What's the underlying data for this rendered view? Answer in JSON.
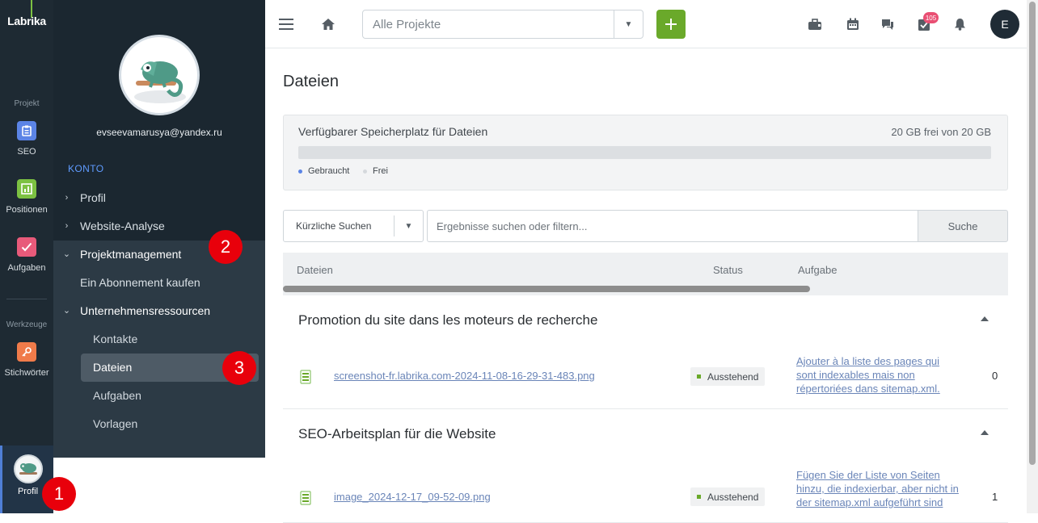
{
  "rail": {
    "logo": "Labrika",
    "section_project": "Projekt",
    "section_tools": "Werkzeuge",
    "items": [
      {
        "label": "SEO",
        "icon": "clipboard-icon",
        "color": "#5b84e6"
      },
      {
        "label": "Positionen",
        "icon": "chart-icon",
        "color": "#7cc142"
      },
      {
        "label": "Aufgaben",
        "icon": "check-icon",
        "color": "#e85a7a"
      },
      {
        "label": "Stichwörter",
        "icon": "key-icon",
        "color": "#f07b4a"
      }
    ],
    "profile_label": "Profil"
  },
  "account": {
    "email": "evseevamarusya@yandex.ru",
    "section": "KONTO",
    "menu": [
      {
        "label": "Profil",
        "expanded": false
      },
      {
        "label": "Website-Analyse",
        "expanded": false
      },
      {
        "label": "Projektmanagement",
        "expanded": true
      },
      {
        "label": "Ein Abonnement kaufen"
      },
      {
        "label": "Unternehmensressourcen",
        "expanded": true
      }
    ],
    "submenu": [
      {
        "label": "Kontakte"
      },
      {
        "label": "Dateien",
        "active": true
      },
      {
        "label": "Aufgaben"
      },
      {
        "label": "Vorlagen"
      }
    ]
  },
  "topbar": {
    "project_placeholder": "Alle Projekte",
    "badge_count": "105",
    "user_initial": "E",
    "icons": [
      "menu-icon",
      "home-icon",
      "briefcase-icon",
      "calendar-icon",
      "chat-icon",
      "tasks-icon",
      "bell-icon"
    ]
  },
  "page": {
    "title": "Dateien",
    "storage": {
      "label": "Verfügbarer Speicherplatz für Dateien",
      "free_text": "20 GB frei von 20 GB",
      "used_fraction": 0,
      "legend_used": "Gebraucht",
      "legend_free": "Frei",
      "used_color": "#5b84e6",
      "free_color": "#d5d9dc"
    },
    "search": {
      "recent_label": "Kürzliche Suchen",
      "placeholder": "Ergebnisse suchen oder filtern...",
      "button": "Suche"
    },
    "table": {
      "headers": [
        "Dateien",
        "Status",
        "Aufgabe"
      ],
      "groups": [
        {
          "title": "Promotion du site dans les moteurs de recherche",
          "file": "screenshot-fr.labrika.com-2024-11-08-16-29-31-483.png",
          "status": "Ausstehend",
          "task": "Ajouter à la liste des pages qui sont indexables mais non répertoriées dans sitemap.xml.",
          "edge": "0"
        },
        {
          "title": "SEO-Arbeitsplan für die Website",
          "file": "image_2024-12-17_09-52-09.png",
          "status": "Ausstehend",
          "task": "Fügen Sie der Liste von Seiten hinzu, die indexierbar, aber nicht in der sitemap.xml aufgeführt sind",
          "edge": "1"
        }
      ]
    }
  },
  "annotations": [
    "1",
    "2",
    "3"
  ]
}
